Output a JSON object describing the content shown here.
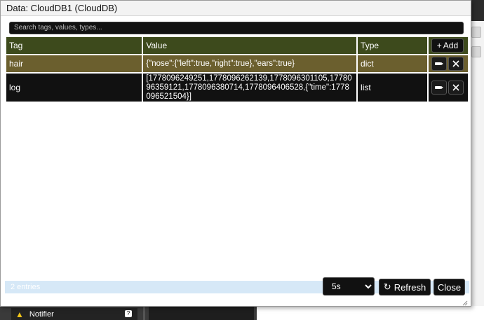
{
  "dialog": {
    "title": "Data: CloudDB1 (CloudDB)",
    "search_placeholder": "Search tags, values, types...",
    "columns": {
      "tag": "Tag",
      "value": "Value",
      "type": "Type"
    },
    "add_label": "Add",
    "rows": [
      {
        "tag": "hair",
        "value": "{\"nose\":{\"left\":true,\"right\":true},\"ears\":true}",
        "type": "dict",
        "selected": true
      },
      {
        "tag": "log",
        "value": "[1778096249251,1778096262139,1778096301105,1778096359121,1778096380714,1778096406528,{\"time\":1778096521504}]",
        "type": "list",
        "selected": false
      }
    ],
    "footer": {
      "entries_label": "2 entries",
      "interval": "5s",
      "interval_options": [
        "5s"
      ],
      "refresh_label": "Refresh",
      "close_label": "Close"
    }
  },
  "background": {
    "notifier_label": "Notifier",
    "notifier_badge": "?"
  },
  "icons": {
    "add": "plus-icon",
    "edit": "pencil-icon",
    "delete": "close-icon",
    "refresh": "refresh-icon",
    "warning": "warning-icon",
    "resize": "resize-grip-icon"
  },
  "colors": {
    "header_bg": "#3d4a1c",
    "selected_row_bg": "#6b5f2e",
    "row_bg": "#111111",
    "footer_bg": "#d6e8f7"
  }
}
